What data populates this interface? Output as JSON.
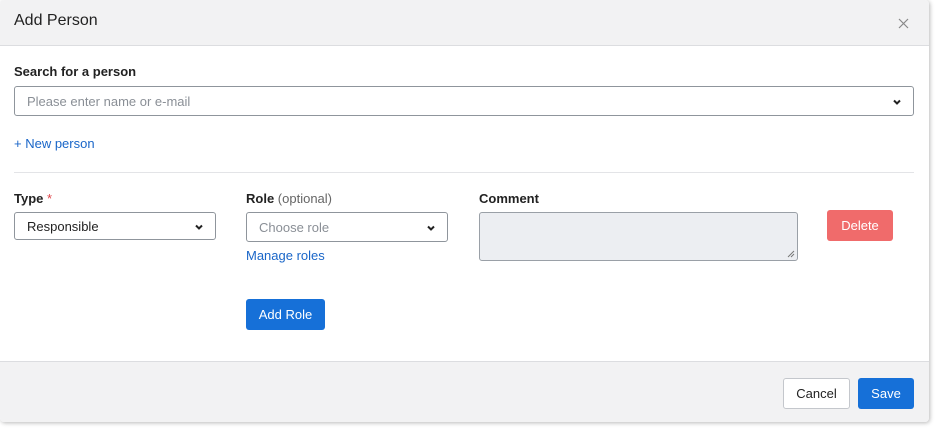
{
  "dialog": {
    "title": "Add Person"
  },
  "search": {
    "label": "Search for a person",
    "placeholder": "Please enter name or e-mail"
  },
  "new_person_link": "+ New person",
  "type": {
    "label": "Type",
    "required_marker": "*",
    "value": "Responsible"
  },
  "role": {
    "label": "Role",
    "optional_hint": "(optional)",
    "placeholder": "Choose role",
    "manage_link": "Manage roles",
    "add_button": "Add Role"
  },
  "comment": {
    "label": "Comment"
  },
  "delete_button": "Delete",
  "footer": {
    "cancel": "Cancel",
    "save": "Save"
  },
  "colors": {
    "primary": "#1670d8",
    "danger": "#f06b6b",
    "link": "#1a66c8"
  }
}
